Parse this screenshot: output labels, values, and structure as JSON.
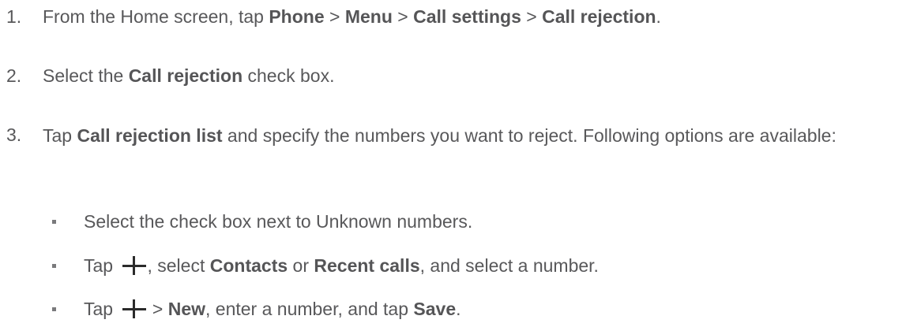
{
  "steps": [
    {
      "number": "1.",
      "parts": {
        "t1": "From the Home screen, tap ",
        "b1": "Phone",
        "t2": " > ",
        "b2": "Menu",
        "t3": " > ",
        "b3": "Call settings",
        "t4": " > ",
        "b4": "Call rejection",
        "t5": "."
      }
    },
    {
      "number": "2.",
      "parts": {
        "t1": "Select the ",
        "b1": "Call rejection",
        "t2": " check box."
      }
    },
    {
      "number": "3.",
      "parts": {
        "t1": "Tap ",
        "b1": "Call rejection list",
        "t2": " and specify the numbers you want to reject. Following options are available:"
      }
    }
  ],
  "bullets": [
    {
      "icon": "square-bullet",
      "parts": {
        "t1": "Select the check box next to Unknown numbers."
      }
    },
    {
      "icon": "square-bullet",
      "inline_icon": "plus-icon",
      "parts": {
        "t1": "Tap ",
        "t2": ", select ",
        "b1": "Contacts",
        "t3": " or ",
        "b2": "Recent calls",
        "t4": ", and select a number."
      }
    },
    {
      "icon": "square-bullet",
      "inline_icon": "plus-icon",
      "parts": {
        "t1": "Tap ",
        "t2": " > ",
        "b1": "New",
        "t3": ", enter a number, and tap ",
        "b2": "Save",
        "t4": "."
      }
    }
  ]
}
